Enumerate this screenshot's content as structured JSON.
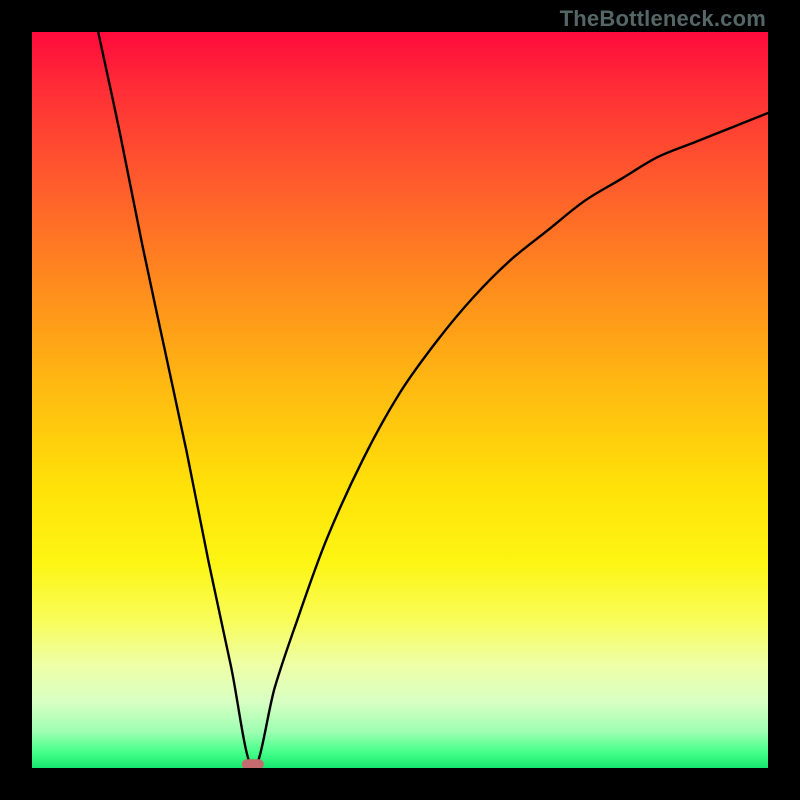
{
  "watermark": "TheBottleneck.com",
  "chart_data": {
    "type": "line",
    "title": "",
    "xlabel": "",
    "ylabel": "",
    "xlim": [
      0,
      100
    ],
    "ylim": [
      0,
      100
    ],
    "grid": false,
    "legend": false,
    "minimum_x": 30,
    "series": [
      {
        "name": "bottleneck-curve",
        "x": [
          9,
          12,
          15,
          18,
          21,
          24,
          27,
          30,
          33,
          36,
          40,
          45,
          50,
          55,
          60,
          65,
          70,
          75,
          80,
          85,
          90,
          95,
          100
        ],
        "y": [
          100,
          86,
          71,
          57,
          43,
          28,
          14,
          0,
          11,
          20,
          31,
          42,
          51,
          58,
          64,
          69,
          73,
          77,
          80,
          83,
          85,
          87,
          89
        ]
      }
    ],
    "annotations": [
      {
        "type": "marker",
        "shape": "pill",
        "x": 30,
        "y": 0.5,
        "color": "#c46b6e"
      }
    ],
    "background": "vertical-gradient red→orange→yellow→green"
  },
  "colors": {
    "curve": "#000000",
    "marker": "#c46b6e",
    "frame": "#000000"
  }
}
